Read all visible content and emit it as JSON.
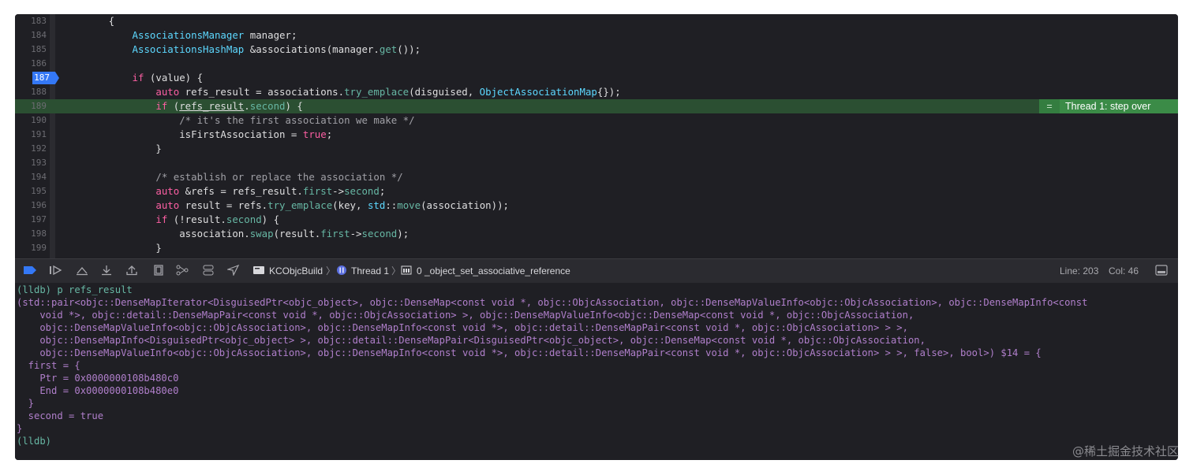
{
  "editor": {
    "lines": [
      {
        "num": "183",
        "tokens": [
          {
            "t": "        {",
            "c": "pl"
          }
        ]
      },
      {
        "num": "184",
        "tokens": [
          {
            "t": "            ",
            "c": "pl"
          },
          {
            "t": "AssociationsManager",
            "c": "ty"
          },
          {
            "t": " manager;",
            "c": "pl"
          }
        ]
      },
      {
        "num": "185",
        "tokens": [
          {
            "t": "            ",
            "c": "pl"
          },
          {
            "t": "AssociationsHashMap",
            "c": "ty"
          },
          {
            "t": " &associations(manager.",
            "c": "pl"
          },
          {
            "t": "get",
            "c": "fn"
          },
          {
            "t": "());",
            "c": "pl"
          }
        ]
      },
      {
        "num": "186",
        "tokens": []
      },
      {
        "num": "187",
        "tokens": [
          {
            "t": "            ",
            "c": "pl"
          },
          {
            "t": "if",
            "c": "kw"
          },
          {
            "t": " (value) {",
            "c": "pl"
          }
        ]
      },
      {
        "num": "188",
        "tokens": [
          {
            "t": "                ",
            "c": "pl"
          },
          {
            "t": "auto",
            "c": "kw"
          },
          {
            "t": " refs_result = associations.",
            "c": "pl"
          },
          {
            "t": "try_emplace",
            "c": "fn"
          },
          {
            "t": "(disguised, ",
            "c": "pl"
          },
          {
            "t": "ObjectAssociationMap",
            "c": "ty"
          },
          {
            "t": "{});",
            "c": "pl"
          }
        ]
      },
      {
        "num": "189",
        "tokens": [
          {
            "t": "                ",
            "c": "pl"
          },
          {
            "t": "if",
            "c": "kw"
          },
          {
            "t": " (",
            "c": "pl"
          },
          {
            "t": "refs_result",
            "c": "pl und"
          },
          {
            "t": ".",
            "c": "pl"
          },
          {
            "t": "second",
            "c": "mb"
          },
          {
            "t": ") {",
            "c": "pl"
          }
        ]
      },
      {
        "num": "190",
        "tokens": [
          {
            "t": "                    ",
            "c": "pl"
          },
          {
            "t": "/* it's the first association we make */",
            "c": "cm"
          }
        ]
      },
      {
        "num": "191",
        "tokens": [
          {
            "t": "                    isFirstAssociation = ",
            "c": "pl"
          },
          {
            "t": "true",
            "c": "kw"
          },
          {
            "t": ";",
            "c": "pl"
          }
        ]
      },
      {
        "num": "192",
        "tokens": [
          {
            "t": "                }",
            "c": "pl"
          }
        ]
      },
      {
        "num": "193",
        "tokens": []
      },
      {
        "num": "194",
        "tokens": [
          {
            "t": "                ",
            "c": "pl"
          },
          {
            "t": "/* establish or replace the association */",
            "c": "cm"
          }
        ]
      },
      {
        "num": "195",
        "tokens": [
          {
            "t": "                ",
            "c": "pl"
          },
          {
            "t": "auto",
            "c": "kw"
          },
          {
            "t": " &refs = refs_result.",
            "c": "pl"
          },
          {
            "t": "first",
            "c": "mb"
          },
          {
            "t": "->",
            "c": "pl"
          },
          {
            "t": "second",
            "c": "mb"
          },
          {
            "t": ";",
            "c": "pl"
          }
        ]
      },
      {
        "num": "196",
        "tokens": [
          {
            "t": "                ",
            "c": "pl"
          },
          {
            "t": "auto",
            "c": "kw"
          },
          {
            "t": " result = refs.",
            "c": "pl"
          },
          {
            "t": "try_emplace",
            "c": "fn"
          },
          {
            "t": "(key, ",
            "c": "pl"
          },
          {
            "t": "std",
            "c": "ty"
          },
          {
            "t": "::",
            "c": "pl"
          },
          {
            "t": "move",
            "c": "fn"
          },
          {
            "t": "(association));",
            "c": "pl"
          }
        ]
      },
      {
        "num": "197",
        "tokens": [
          {
            "t": "                ",
            "c": "pl"
          },
          {
            "t": "if",
            "c": "kw"
          },
          {
            "t": " (!result.",
            "c": "pl"
          },
          {
            "t": "second",
            "c": "mb"
          },
          {
            "t": ") {",
            "c": "pl"
          }
        ]
      },
      {
        "num": "198",
        "tokens": [
          {
            "t": "                    association.",
            "c": "pl"
          },
          {
            "t": "swap",
            "c": "fn"
          },
          {
            "t": "(result.",
            "c": "pl"
          },
          {
            "t": "first",
            "c": "mb"
          },
          {
            "t": "->",
            "c": "pl"
          },
          {
            "t": "second",
            "c": "mb"
          },
          {
            "t": ");",
            "c": "pl"
          }
        ]
      },
      {
        "num": "199",
        "tokens": [
          {
            "t": "                }",
            "c": "pl"
          }
        ]
      }
    ],
    "breakpoint_line": "187",
    "current_line": "189",
    "status_badge": "Thread 1: step over"
  },
  "debug_bar": {
    "target": "KCObjcBuild",
    "thread": "Thread 1",
    "frame": "0 _object_set_associative_reference",
    "line_label": "Line: 203",
    "col_label": "Col: 46"
  },
  "console": {
    "lines": [
      "(lldb) p refs_result",
      "(std::pair<objc::DenseMapIterator<DisguisedPtr<objc_object>, objc::DenseMap<const void *, objc::ObjcAssociation, objc::DenseMapValueInfo<objc::ObjcAssociation>, objc::DenseMapInfo<const",
      "    void *>, objc::detail::DenseMapPair<const void *, objc::ObjcAssociation> >, objc::DenseMapValueInfo<objc::DenseMap<const void *, objc::ObjcAssociation,",
      "    objc::DenseMapValueInfo<objc::ObjcAssociation>, objc::DenseMapInfo<const void *>, objc::detail::DenseMapPair<const void *, objc::ObjcAssociation> > >,",
      "    objc::DenseMapInfo<DisguisedPtr<objc_object> >, objc::detail::DenseMapPair<DisguisedPtr<objc_object>, objc::DenseMap<const void *, objc::ObjcAssociation,",
      "    objc::DenseMapValueInfo<objc::ObjcAssociation>, objc::DenseMapInfo<const void *>, objc::detail::DenseMapPair<const void *, objc::ObjcAssociation> > >, false>, bool>) $14 = {",
      "  first = {",
      "    Ptr = 0x0000000108b480c0",
      "    End = 0x0000000108b480e0",
      "  }",
      "  second = true",
      "}",
      "(lldb)"
    ]
  },
  "watermark": "@稀土掘金技术社区"
}
